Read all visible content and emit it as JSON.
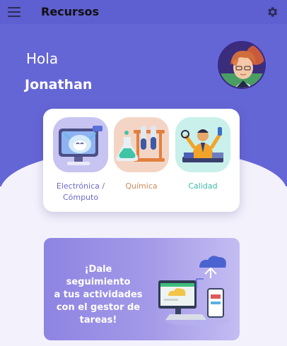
{
  "header": {
    "title": "Recursos",
    "menu_icon": "menu-icon",
    "settings_icon": "gear-icon"
  },
  "greeting": {
    "hello": "Hola",
    "name": "Jonathan"
  },
  "colors": {
    "primary": "#6566d6",
    "topbar": "#5e5fd0",
    "background": "#f3f1fc"
  },
  "categories": [
    {
      "label_line1": "Electrónica /",
      "label_line2": "Cómputo",
      "color": "#6d69c9",
      "icon": "computer-robot-icon"
    },
    {
      "label_line1": "Química",
      "label_line2": "",
      "color": "#d08b5b",
      "icon": "lab-flask-icon"
    },
    {
      "label_line1": "Calidad",
      "label_line2": "",
      "color": "#3fbaa6",
      "icon": "quality-worker-icon"
    }
  ],
  "promo": {
    "line1": "¡Dale seguimiento",
    "line2": "a tus actividades",
    "line3": "con el gestor de",
    "line4": "tareas!",
    "icon": "cloud-devices-icon"
  }
}
